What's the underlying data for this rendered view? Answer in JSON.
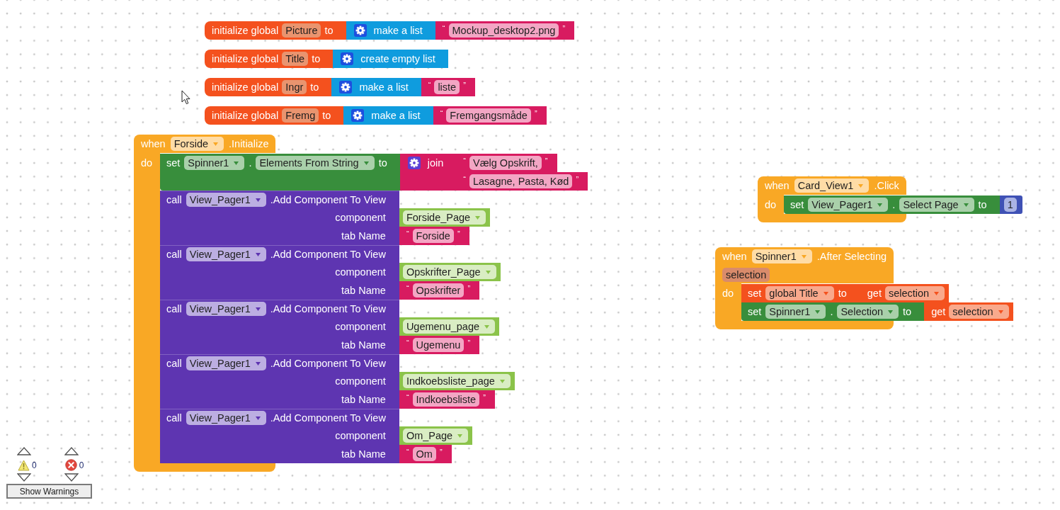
{
  "globals": [
    {
      "keyword": "initialize global",
      "name": "Picture",
      "to": "to",
      "value": {
        "kind": "list",
        "label": "make a list",
        "items": [
          {
            "kind": "text",
            "open": "“",
            "text": "Mockup_desktop2.png",
            "close": "”"
          }
        ]
      }
    },
    {
      "keyword": "initialize global",
      "name": "Title",
      "to": "to",
      "value": {
        "kind": "list",
        "label": "create empty list"
      }
    },
    {
      "keyword": "initialize global",
      "name": "Ingr",
      "to": "to",
      "value": {
        "kind": "list",
        "label": "make a list",
        "items": [
          {
            "kind": "text",
            "open": "“",
            "text": "liste",
            "close": "”"
          }
        ]
      }
    },
    {
      "keyword": "initialize global",
      "name": "Fremg",
      "to": "to",
      "value": {
        "kind": "list",
        "label": "make a list",
        "items": [
          {
            "kind": "text",
            "open": "“",
            "text": "Fremgangsmåde",
            "close": "”"
          }
        ]
      }
    }
  ],
  "events": [
    {
      "when": "when",
      "component": "Forside",
      "event": ".Initialize",
      "do": "do",
      "statements": [
        {
          "kind": "set",
          "keyword": "set",
          "component": "Spinner1",
          "dot": ".",
          "property": "Elements From String",
          "to": "to",
          "value": {
            "kind": "join",
            "label": "join",
            "items": [
              {
                "kind": "text",
                "open": "“",
                "text": "Vælg Opskrift,",
                "close": "”"
              },
              {
                "kind": "text",
                "open": "“",
                "text": "Lasagne, Pasta, Kød",
                "close": "”"
              }
            ]
          }
        },
        {
          "kind": "call",
          "keyword": "call",
          "component": "View_Pager1",
          "method": ".Add Component To View",
          "args": [
            {
              "label": "component",
              "value": {
                "kind": "component",
                "text": "Forside_Page"
              }
            },
            {
              "label": "tab Name",
              "value": {
                "kind": "text",
                "open": "“",
                "text": "Forside",
                "close": "”"
              }
            }
          ]
        },
        {
          "kind": "call",
          "keyword": "call",
          "component": "View_Pager1",
          "method": ".Add Component To View",
          "args": [
            {
              "label": "component",
              "value": {
                "kind": "component",
                "text": "Opskrifter_Page"
              }
            },
            {
              "label": "tab Name",
              "value": {
                "kind": "text",
                "open": "“",
                "text": "Opskrifter",
                "close": "”"
              }
            }
          ]
        },
        {
          "kind": "call",
          "keyword": "call",
          "component": "View_Pager1",
          "method": ".Add Component To View",
          "args": [
            {
              "label": "component",
              "value": {
                "kind": "component",
                "text": "Ugemenu_page"
              }
            },
            {
              "label": "tab Name",
              "value": {
                "kind": "text",
                "open": "“",
                "text": "Ugemenu",
                "close": "”"
              }
            }
          ]
        },
        {
          "kind": "call",
          "keyword": "call",
          "component": "View_Pager1",
          "method": ".Add Component To View",
          "args": [
            {
              "label": "component",
              "value": {
                "kind": "component",
                "text": "Indkoebsliste_page"
              }
            },
            {
              "label": "tab Name",
              "value": {
                "kind": "text",
                "open": "“",
                "text": "Indkoebsliste",
                "close": "”"
              }
            }
          ]
        },
        {
          "kind": "call",
          "keyword": "call",
          "component": "View_Pager1",
          "method": ".Add Component To View",
          "args": [
            {
              "label": "component",
              "value": {
                "kind": "component",
                "text": "Om_Page"
              }
            },
            {
              "label": "tab Name",
              "value": {
                "kind": "text",
                "open": "“",
                "text": "Om",
                "close": "”"
              }
            }
          ]
        }
      ]
    },
    {
      "when": "when",
      "component": "Card_View1",
      "event": ".Click",
      "do": "do",
      "statements": [
        {
          "kind": "set",
          "keyword": "set",
          "component": "View_Pager1",
          "dot": ".",
          "property": "Select Page",
          "to": "to",
          "value": {
            "kind": "number",
            "text": "1"
          }
        }
      ]
    },
    {
      "when": "when",
      "component": "Spinner1",
      "event": ".After Selecting",
      "params": [
        "selection"
      ],
      "do": "do",
      "statements": [
        {
          "kind": "set_var",
          "keyword": "set",
          "variable": "global Title",
          "to": "to",
          "value": {
            "kind": "get",
            "keyword": "get",
            "variable": "selection"
          }
        },
        {
          "kind": "set",
          "keyword": "set",
          "component": "Spinner1",
          "dot": ".",
          "property": "Selection",
          "to": "to",
          "value": {
            "kind": "get",
            "keyword": "get",
            "variable": "selection"
          }
        }
      ]
    }
  ],
  "warnings": {
    "warning_count": "0",
    "error_count": "0",
    "button": "Show Warnings"
  }
}
